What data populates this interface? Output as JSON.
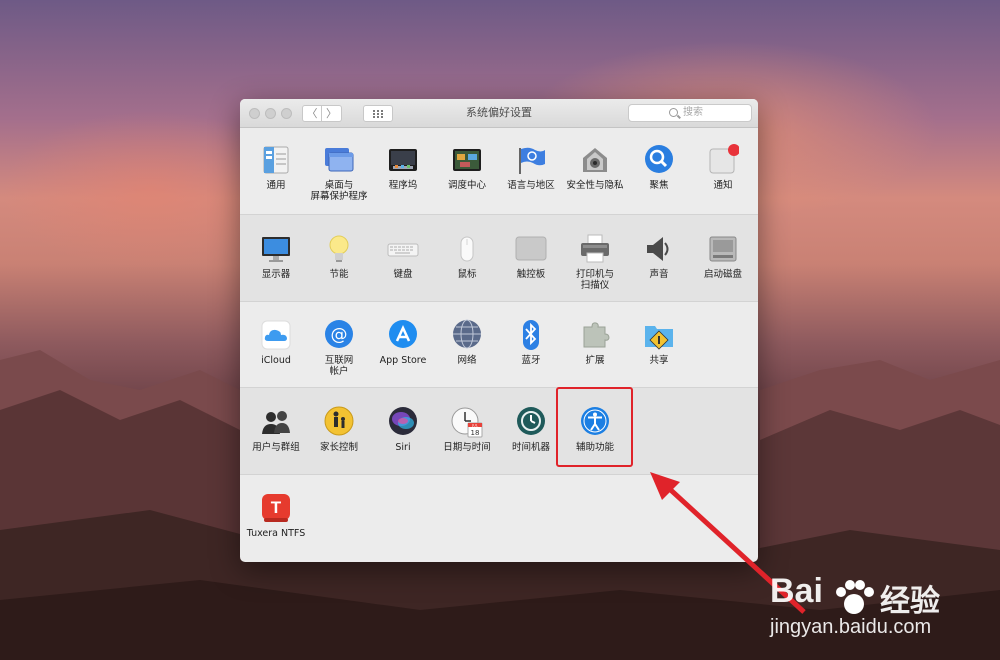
{
  "window": {
    "title": "系统偏好设置",
    "search_placeholder": "搜索",
    "back_glyph": "〈",
    "forward_glyph": "〉"
  },
  "rows": [
    [
      {
        "id": "general",
        "label": "通用",
        "icon": "general-icon"
      },
      {
        "id": "desktop",
        "label": "桌面与\n屏幕保护程序",
        "icon": "desktop-screensaver-icon"
      },
      {
        "id": "dock",
        "label": "程序坞",
        "icon": "dock-icon"
      },
      {
        "id": "mission",
        "label": "调度中心",
        "icon": "mission-control-icon"
      },
      {
        "id": "language",
        "label": "语言与地区",
        "icon": "language-region-icon"
      },
      {
        "id": "security",
        "label": "安全性与隐私",
        "icon": "security-privacy-icon"
      },
      {
        "id": "spotlight",
        "label": "聚焦",
        "icon": "spotlight-icon"
      },
      {
        "id": "notifications",
        "label": "通知",
        "icon": "notifications-icon"
      }
    ],
    [
      {
        "id": "displays",
        "label": "显示器",
        "icon": "display-icon"
      },
      {
        "id": "energy",
        "label": "节能",
        "icon": "energy-saver-icon"
      },
      {
        "id": "keyboard",
        "label": "键盘",
        "icon": "keyboard-icon"
      },
      {
        "id": "mouse",
        "label": "鼠标",
        "icon": "mouse-icon"
      },
      {
        "id": "trackpad",
        "label": "触控板",
        "icon": "trackpad-icon"
      },
      {
        "id": "printers",
        "label": "打印机与\n扫描仪",
        "icon": "printer-scanner-icon"
      },
      {
        "id": "sound",
        "label": "声音",
        "icon": "sound-icon"
      },
      {
        "id": "startup",
        "label": "启动磁盘",
        "icon": "startup-disk-icon"
      }
    ],
    [
      {
        "id": "icloud",
        "label": "iCloud",
        "icon": "icloud-icon"
      },
      {
        "id": "internet",
        "label": "互联网\n帐户",
        "icon": "internet-accounts-icon"
      },
      {
        "id": "appstore",
        "label": "App Store",
        "icon": "app-store-icon"
      },
      {
        "id": "network",
        "label": "网络",
        "icon": "network-icon"
      },
      {
        "id": "bluetooth",
        "label": "蓝牙",
        "icon": "bluetooth-icon"
      },
      {
        "id": "extensions",
        "label": "扩展",
        "icon": "extensions-icon"
      },
      {
        "id": "sharing",
        "label": "共享",
        "icon": "sharing-icon"
      }
    ],
    [
      {
        "id": "users",
        "label": "用户与群组",
        "icon": "users-groups-icon"
      },
      {
        "id": "parental",
        "label": "家长控制",
        "icon": "parental-controls-icon"
      },
      {
        "id": "siri",
        "label": "Siri",
        "icon": "siri-icon"
      },
      {
        "id": "datetime",
        "label": "日期与时间",
        "icon": "date-time-icon"
      },
      {
        "id": "timemachine",
        "label": "时间机器",
        "icon": "time-machine-icon"
      },
      {
        "id": "accessibility",
        "label": "辅助功能",
        "icon": "accessibility-icon"
      }
    ],
    [
      {
        "id": "tuxera",
        "label": "Tuxera NTFS",
        "icon": "tuxera-ntfs-icon"
      }
    ]
  ],
  "calendar_icon": {
    "month": "JUL",
    "day": "18"
  },
  "watermark": {
    "brand": "Bai",
    "brand_cn": "经验",
    "url": "jingyan.baidu.com"
  },
  "colors": {
    "highlight": "#e0232a",
    "arrow": "#e0232a"
  }
}
